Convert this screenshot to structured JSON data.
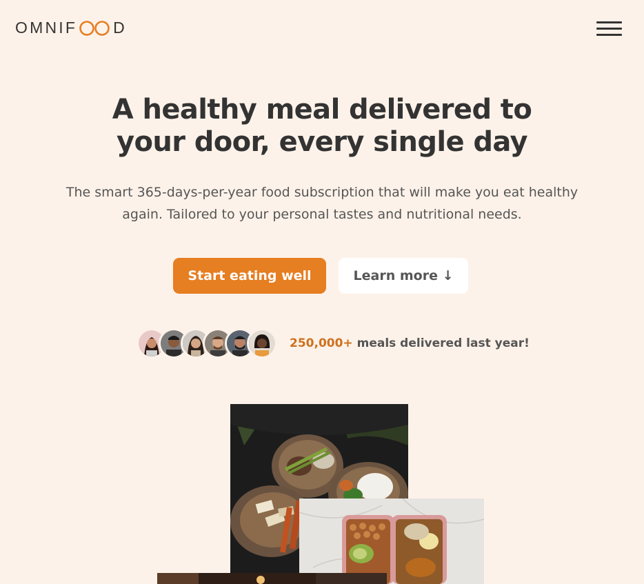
{
  "header": {
    "logo_left": "OMNIF",
    "logo_right": "D",
    "menu_icon": "hamburger-menu-icon"
  },
  "hero": {
    "title": "A healthy meal delivered to your door, every single day",
    "description": "The smart 365-days-per-year food subscription that will make you eat healthy again. Tailored to your personal tastes and nutritional needs.",
    "primary_button": "Start eating well",
    "secondary_button": "Learn more ↓"
  },
  "delivered": {
    "count": "250,000+",
    "text": " meals delivered last year!"
  },
  "colors": {
    "background": "#fdf2e9",
    "accent": "#e67e22",
    "accent_dark": "#cf711f",
    "text": "#333333"
  }
}
